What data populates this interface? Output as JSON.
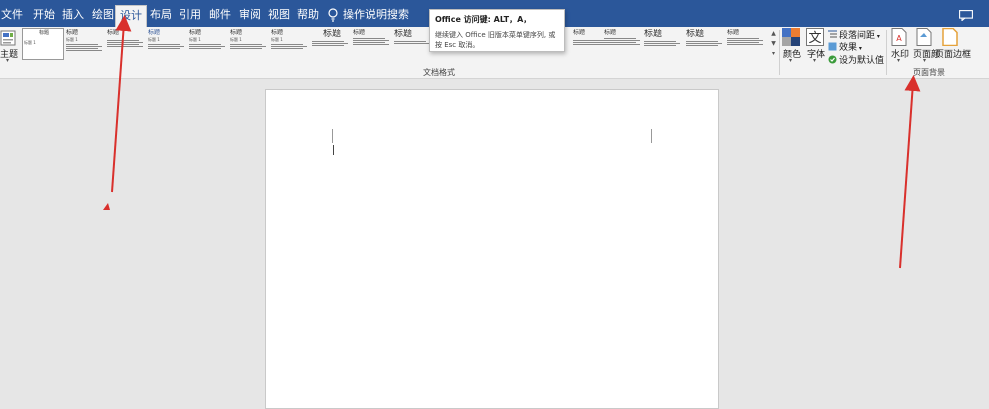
{
  "tabs": {
    "file": "文件",
    "home": "开始",
    "insert": "插入",
    "draw": "绘图",
    "design": "设计",
    "layout": "布局",
    "references": "引用",
    "mailings": "邮件",
    "review": "审阅",
    "view": "视图",
    "help": "帮助"
  },
  "tell_me": "操作说明搜索",
  "tooltip": {
    "title": "Office 访问键: ALT，A，",
    "body": "继续键入 Office 旧版本菜单键序列, 或按 Esc 取消。"
  },
  "ribbon": {
    "themes_label": "主题",
    "styles_group_label": "文档格式",
    "style_heading": "标题",
    "style_heading1": "标题 1",
    "style_title_small": "标题",
    "colors_label": "颜色",
    "fonts_label": "字体",
    "paragraph_spacing_label": "段落间距",
    "effects_label": "效果",
    "set_default_label": "设为默认值",
    "watermark_label": "水印",
    "page_color_label": "页面颜",
    "page_borders_label": "页面边框",
    "page_background_group_label": "页面背景"
  },
  "colors": {
    "title_bar": "#2b579a",
    "ribbon_bg": "#f3f3f3",
    "workspace_bg": "#e6e6e6",
    "annotation_arrow": "#d9302c",
    "heading_blue": "#2f5597"
  }
}
